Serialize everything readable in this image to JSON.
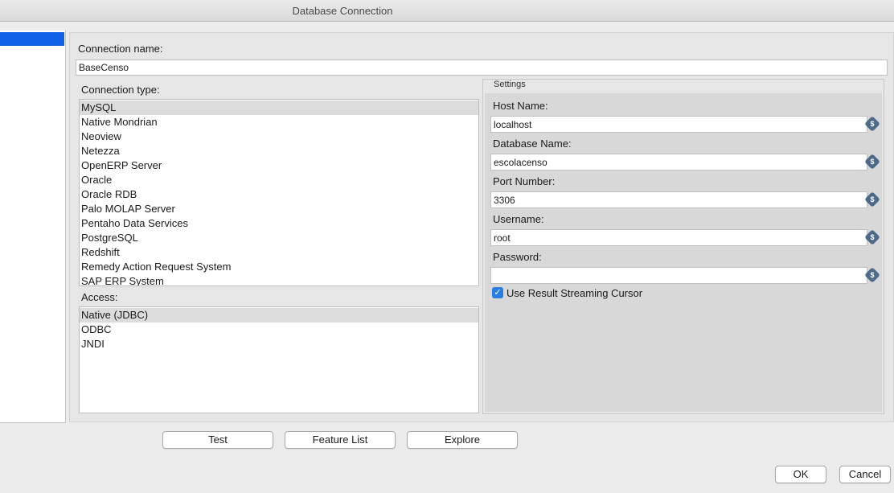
{
  "window": {
    "title": "Database Connection"
  },
  "connection": {
    "name_label": "Connection name:",
    "name_value": "BaseCenso",
    "type_label": "Connection type:",
    "types": [
      "MySQL",
      "Native Mondrian",
      "Neoview",
      "Netezza",
      "OpenERP Server",
      "Oracle",
      "Oracle RDB",
      "Palo MOLAP Server",
      "Pentaho Data Services",
      "PostgreSQL",
      "Redshift",
      "Remedy Action Request System",
      "SAP ERP System"
    ],
    "selected_type": "MySQL",
    "access_label": "Access:",
    "access": [
      "Native (JDBC)",
      "ODBC",
      "JNDI"
    ],
    "selected_access": "Native (JDBC)"
  },
  "settings": {
    "legend": "Settings",
    "host_label": "Host Name:",
    "host_value": "localhost",
    "db_label": "Database Name:",
    "db_value": "escolacenso",
    "port_label": "Port Number:",
    "port_value": "3306",
    "user_label": "Username:",
    "user_value": "root",
    "password_label": "Password:",
    "password_value": "",
    "streaming_label": "Use Result Streaming Cursor",
    "streaming_checked": true,
    "variable_icon_glyph": "$"
  },
  "buttons": {
    "test": "Test",
    "feature_list": "Feature List",
    "explore": "Explore",
    "ok": "OK",
    "cancel": "Cancel"
  },
  "colors": {
    "selection_blue": "#1060e8",
    "checkbox_blue": "#2a7de1",
    "variable_icon": "#4d6a8a"
  }
}
